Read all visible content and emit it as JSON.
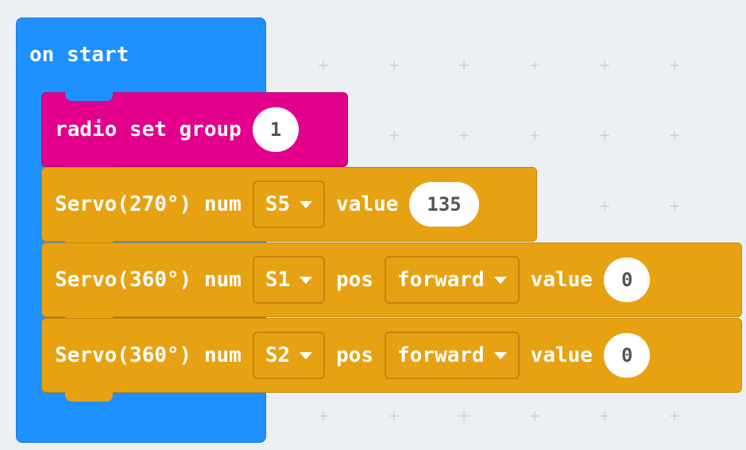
{
  "workspace": {
    "hat_block": {
      "label": "on start",
      "color": "#1e90ff"
    },
    "radio_block": {
      "label": "radio set group",
      "group_value": "1",
      "color": "#e3008c"
    },
    "servo_blocks": [
      {
        "prefix": "Servo(270°) num",
        "num": "S5",
        "value_label": "value",
        "value": "135"
      },
      {
        "prefix": "Servo(360°) num",
        "num": "S1",
        "pos_label": "pos",
        "direction": "forward",
        "value_label": "value",
        "value": "0"
      },
      {
        "prefix": "Servo(360°) num",
        "num": "S2",
        "pos_label": "pos",
        "direction": "forward",
        "value_label": "value",
        "value": "0"
      }
    ],
    "servo_color": "#e7a214"
  }
}
